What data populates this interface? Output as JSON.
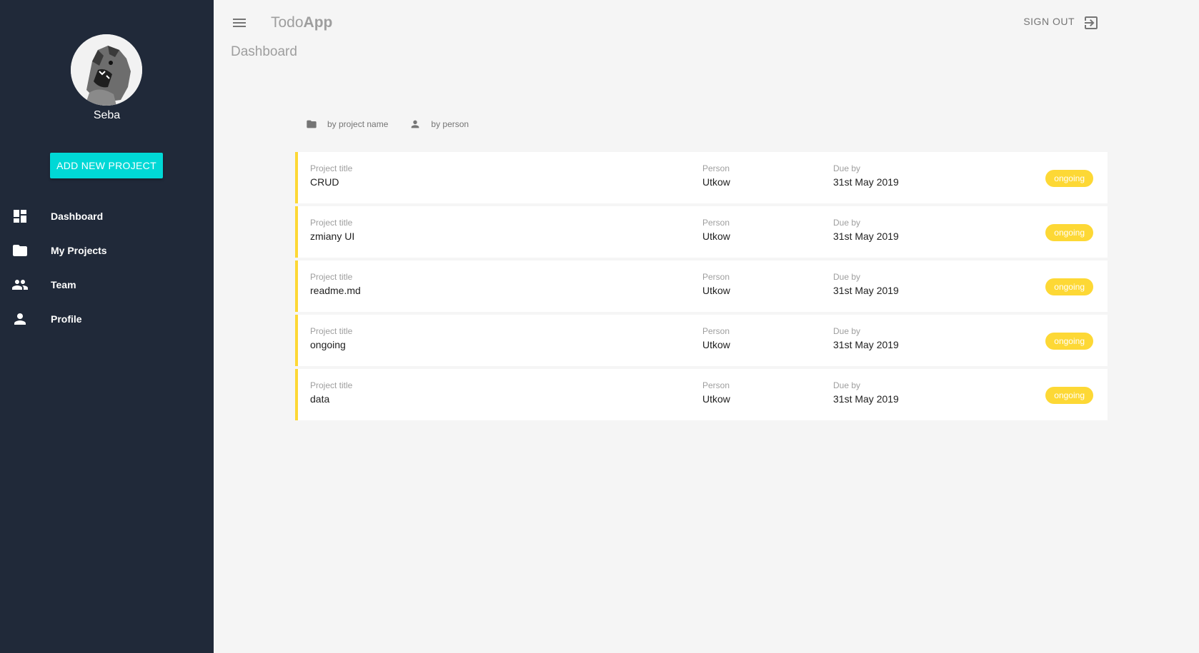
{
  "app": {
    "brand_part1": "Todo",
    "brand_part2": "App",
    "page_title": "Dashboard",
    "signout_label": "SIGN OUT"
  },
  "sidebar": {
    "user_name": "Seba",
    "add_button_label": "ADD NEW PROJECT",
    "items": [
      {
        "label": "Dashboard",
        "icon": "dashboard-icon"
      },
      {
        "label": "My Projects",
        "icon": "folder-icon"
      },
      {
        "label": "Team",
        "icon": "people-icon"
      },
      {
        "label": "Profile",
        "icon": "person-icon"
      }
    ]
  },
  "sort": {
    "by_project": "by project name",
    "by_person": "by person"
  },
  "labels": {
    "title": "Project title",
    "person": "Person",
    "due": "Due by"
  },
  "projects": [
    {
      "title": "CRUD",
      "person": "Utkow",
      "due": "31st May 2019",
      "status": "ongoing"
    },
    {
      "title": "zmiany UI",
      "person": "Utkow",
      "due": "31st May 2019",
      "status": "ongoing"
    },
    {
      "title": "readme.md",
      "person": "Utkow",
      "due": "31st May 2019",
      "status": "ongoing"
    },
    {
      "title": "ongoing",
      "person": "Utkow",
      "due": "31st May 2019",
      "status": "ongoing"
    },
    {
      "title": "data",
      "person": "Utkow",
      "due": "31st May 2019",
      "status": "ongoing"
    }
  ],
  "colors": {
    "sidebar_bg": "#202939",
    "accent": "#00d8d6",
    "status_ongoing": "#fdd835"
  }
}
